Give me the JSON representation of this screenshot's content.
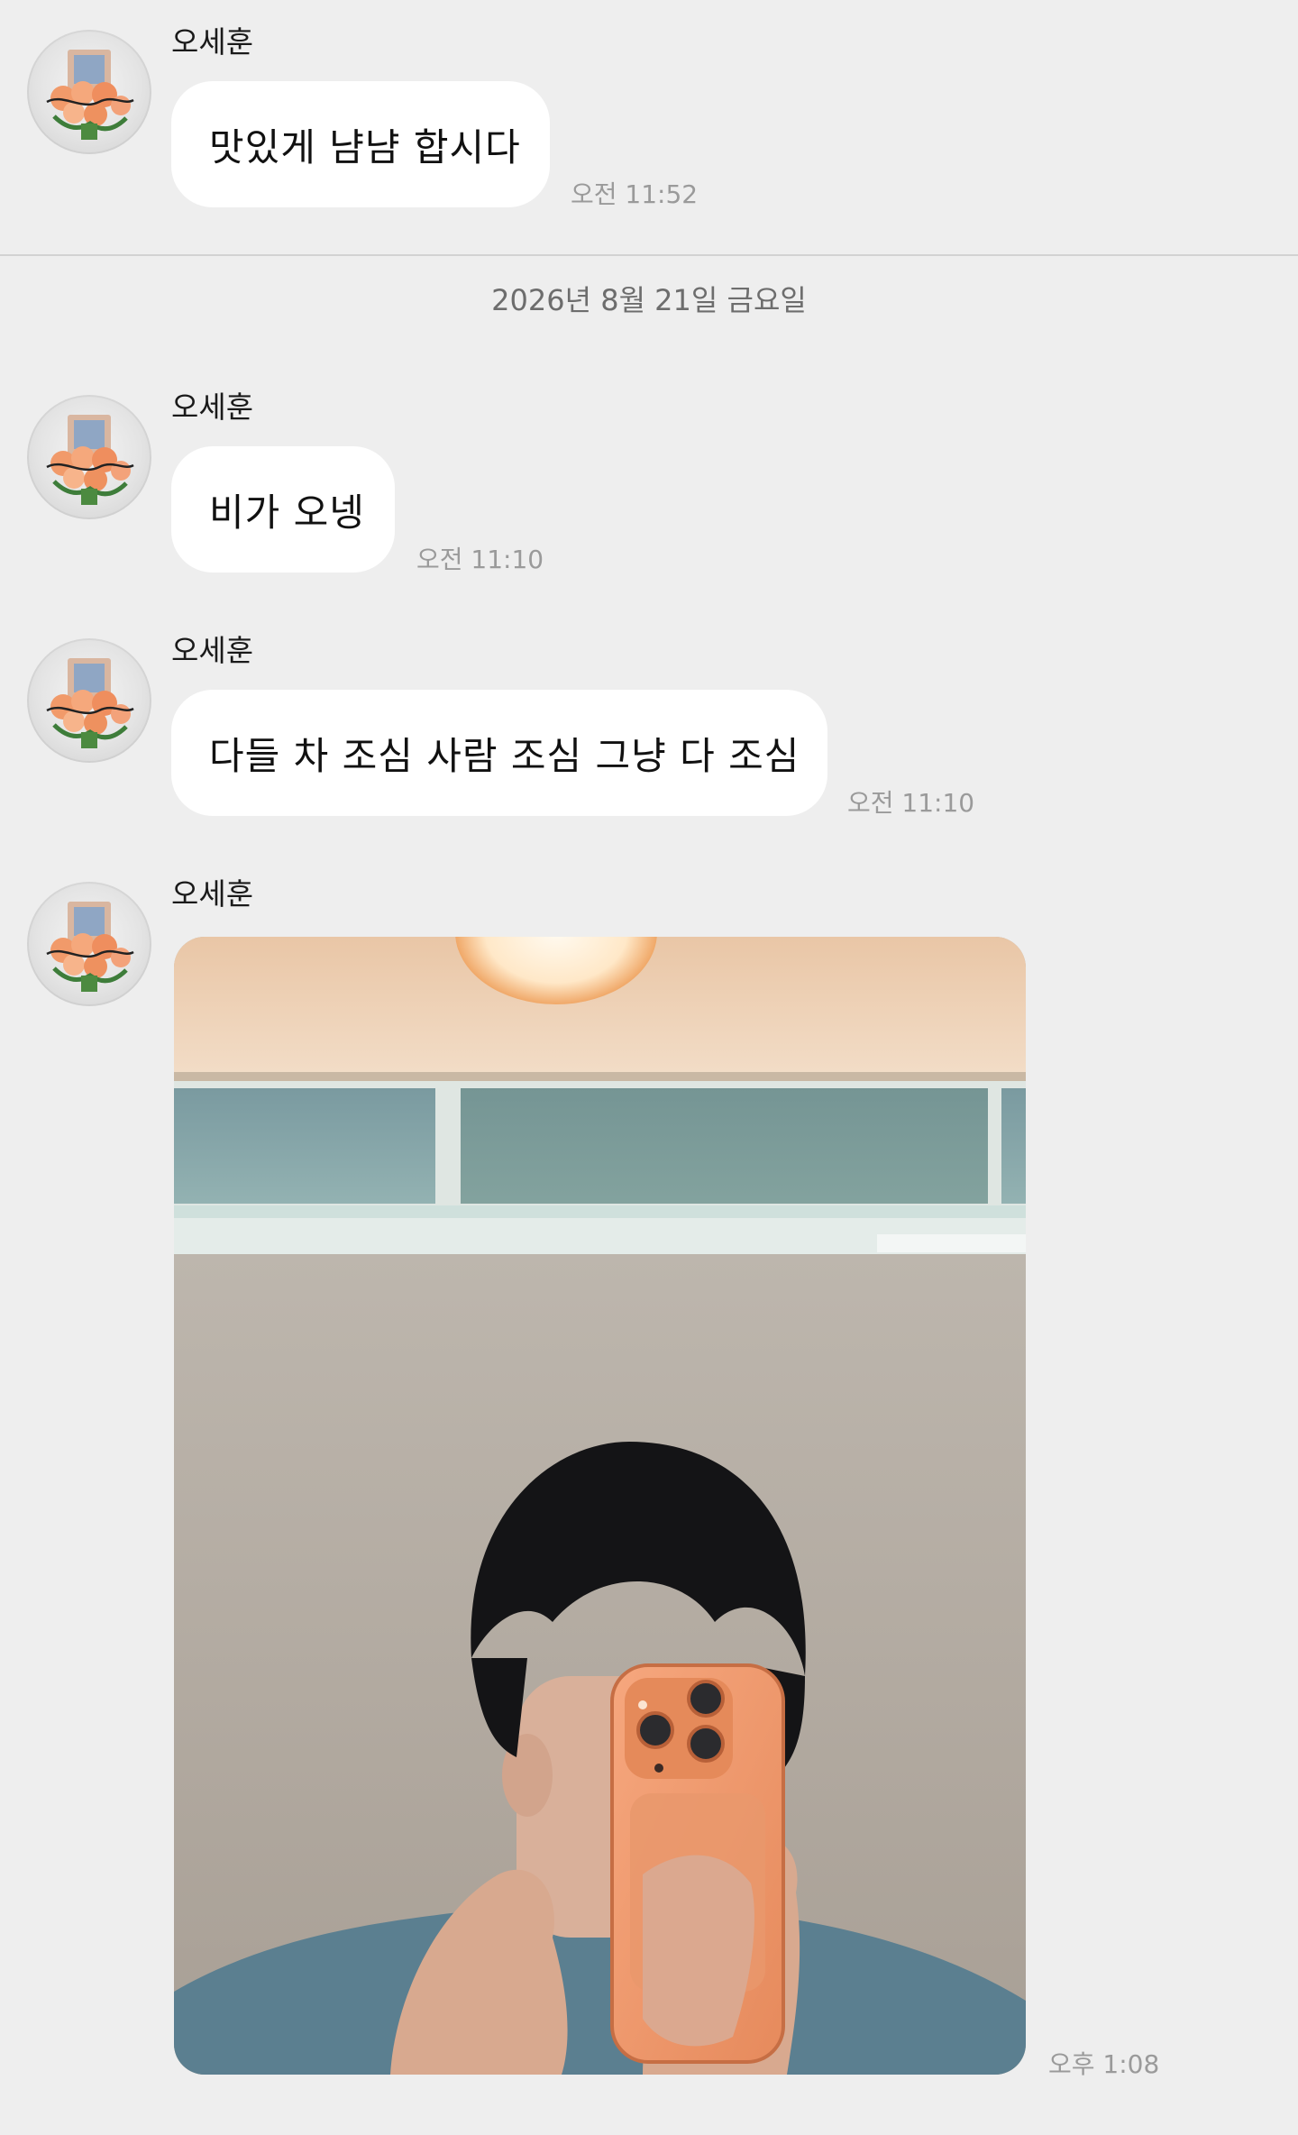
{
  "messages": [
    {
      "sender": "오세훈",
      "text": "맛있게 냠냠 합시다",
      "time": "오전 11:52"
    },
    {
      "sender": "오세훈",
      "text": "비가 오넹",
      "time": "오전 11:10"
    },
    {
      "sender": "오세훈",
      "text": "다들 차 조심 사람 조심 그냥 다 조심",
      "time": "오전 11:10"
    },
    {
      "sender": "오세훈",
      "time": "오후 1:08"
    }
  ],
  "date_separator": "2026년 8월 21일 금요일",
  "colors": {
    "background": "#eeeeee",
    "bubble": "#ffffff",
    "timestamp": "#9a9a9a",
    "divider": "#d2d2d2"
  },
  "icons": [
    "avatar-bouquet-icon"
  ]
}
